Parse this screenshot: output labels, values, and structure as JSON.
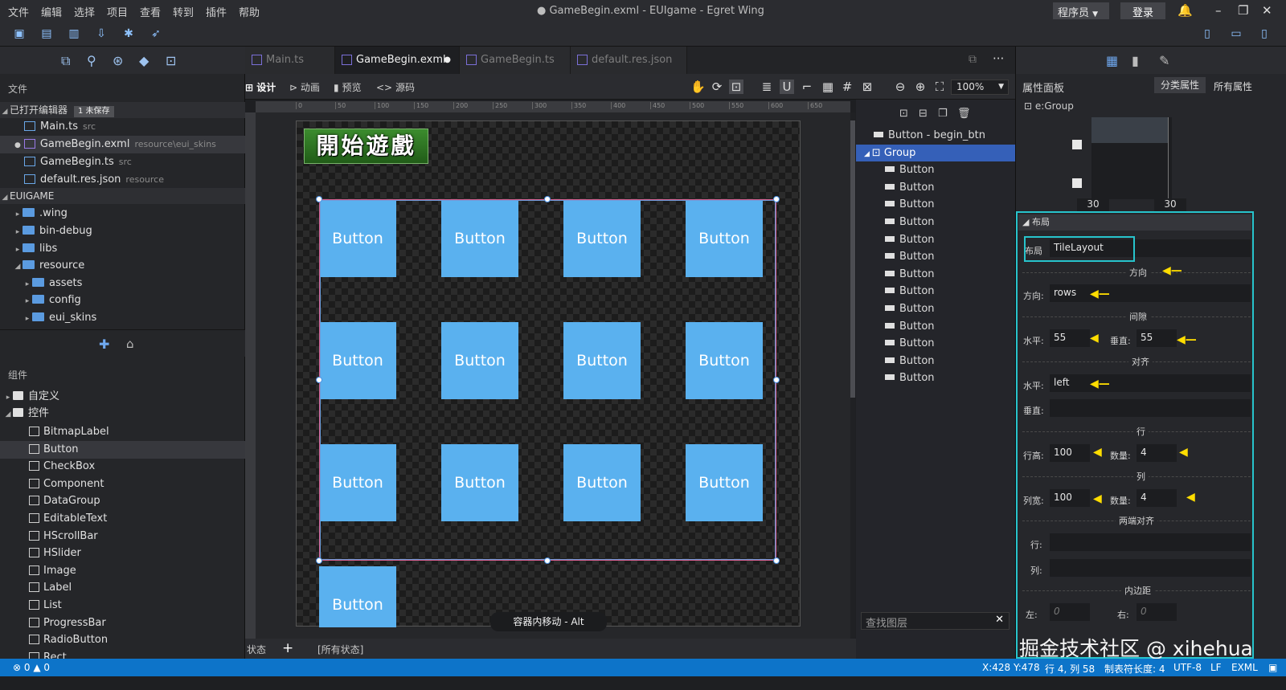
{
  "window": {
    "title": "● GameBegin.exml - EUIgame - Egret Wing",
    "role": "程序员",
    "login": "登录"
  },
  "menu": [
    "文件",
    "编辑",
    "选择",
    "项目",
    "查看",
    "转到",
    "插件",
    "帮助"
  ],
  "explorer": {
    "files_header": "文件",
    "open_editors": "已打开编辑器",
    "unsaved_badge": "1 未保存",
    "open_files": [
      {
        "name": "Main.ts",
        "path": "src"
      },
      {
        "name": "GameBegin.exml",
        "path": "resource\\eui_skins"
      },
      {
        "name": "GameBegin.ts",
        "path": "src"
      },
      {
        "name": "default.res.json",
        "path": "resource"
      }
    ],
    "project": "EUIGAME",
    "folders": [
      ".wing",
      "bin-debug",
      "libs",
      "resource",
      "assets",
      "config",
      "eui_skins"
    ]
  },
  "components": {
    "header": "组件",
    "custom": "自定义",
    "controls": "控件",
    "items": [
      "BitmapLabel",
      "Button",
      "CheckBox",
      "Component",
      "DataGroup",
      "EditableText",
      "HScrollBar",
      "HSlider",
      "Image",
      "Label",
      "List",
      "ProgressBar",
      "RadioButton",
      "Rect"
    ]
  },
  "tabs": [
    "Main.ts",
    "GameBegin.exml",
    "GameBegin.ts",
    "default.res.json"
  ],
  "design_tools": {
    "design": "设计",
    "anim": "动画",
    "preview": "预览",
    "source": "源码",
    "zoom": "100%"
  },
  "ruler_ticks": [
    "0",
    "50",
    "100",
    "150",
    "200",
    "250",
    "300",
    "350",
    "400",
    "450",
    "500",
    "550",
    "600",
    "650"
  ],
  "canvas": {
    "start_image_text": "開始遊戲",
    "button_label": "Button",
    "hint": "容器内移动 - Alt"
  },
  "state_bar": {
    "state": "状态",
    "add": "+",
    "all_states": "[所有状态]"
  },
  "layers": {
    "items": [
      "Button - begin_btn",
      "Group",
      "Button",
      "Button",
      "Button",
      "Button",
      "Button",
      "Button",
      "Button",
      "Button",
      "Button",
      "Button",
      "Button",
      "Button",
      "Button"
    ],
    "search_placeholder": "查找图层"
  },
  "properties": {
    "title": "属性面板",
    "category_btn": "分类属性",
    "all_btn": "所有属性",
    "target": "e:Group",
    "size_values": [
      "30",
      "30"
    ],
    "layout_section": "布局",
    "layout_label": "布局",
    "layout_value": "TileLayout",
    "direction_sep": "方向",
    "direction_label": "方向:",
    "direction_value": "rows",
    "gap_sep": "间隙",
    "gap_h_label": "水平:",
    "gap_h_value": "55",
    "gap_v_label": "垂直:",
    "gap_v_value": "55",
    "align_sep": "对齐",
    "align_h_label": "水平:",
    "align_h_value": "left",
    "align_v_label": "垂直:",
    "align_v_value": "",
    "row_sep": "行",
    "row_height_label": "行高:",
    "row_height_value": "100",
    "row_count_label": "数量:",
    "row_count_value": "4",
    "col_sep": "列",
    "col_width_label": "列宽:",
    "col_width_value": "100",
    "col_count_label": "数量:",
    "col_count_value": "4",
    "justify_sep": "两端对齐",
    "justify_row_label": "行:",
    "justify_col_label": "列:",
    "padding_sep": "内边距",
    "pad_left_label": "左:",
    "pad_left_value": "0",
    "pad_right_label": "右:",
    "pad_right_value": "0"
  },
  "watermark": "掘金技术社区 @ xihehua",
  "status": {
    "errors": "⊗ 0 ▲ 0",
    "cursor": "X:428 Y:478",
    "position": "行 4, 列 58",
    "tab": "制表符长度: 4",
    "encoding": "UTF-8",
    "eol": "LF",
    "lang": "EXML"
  },
  "colors": {
    "accent": "#0d74c9",
    "button": "#5ab1ef",
    "selection": "#3560b8",
    "highlight": "#27c4cc",
    "arrow": "#ffdd00"
  }
}
